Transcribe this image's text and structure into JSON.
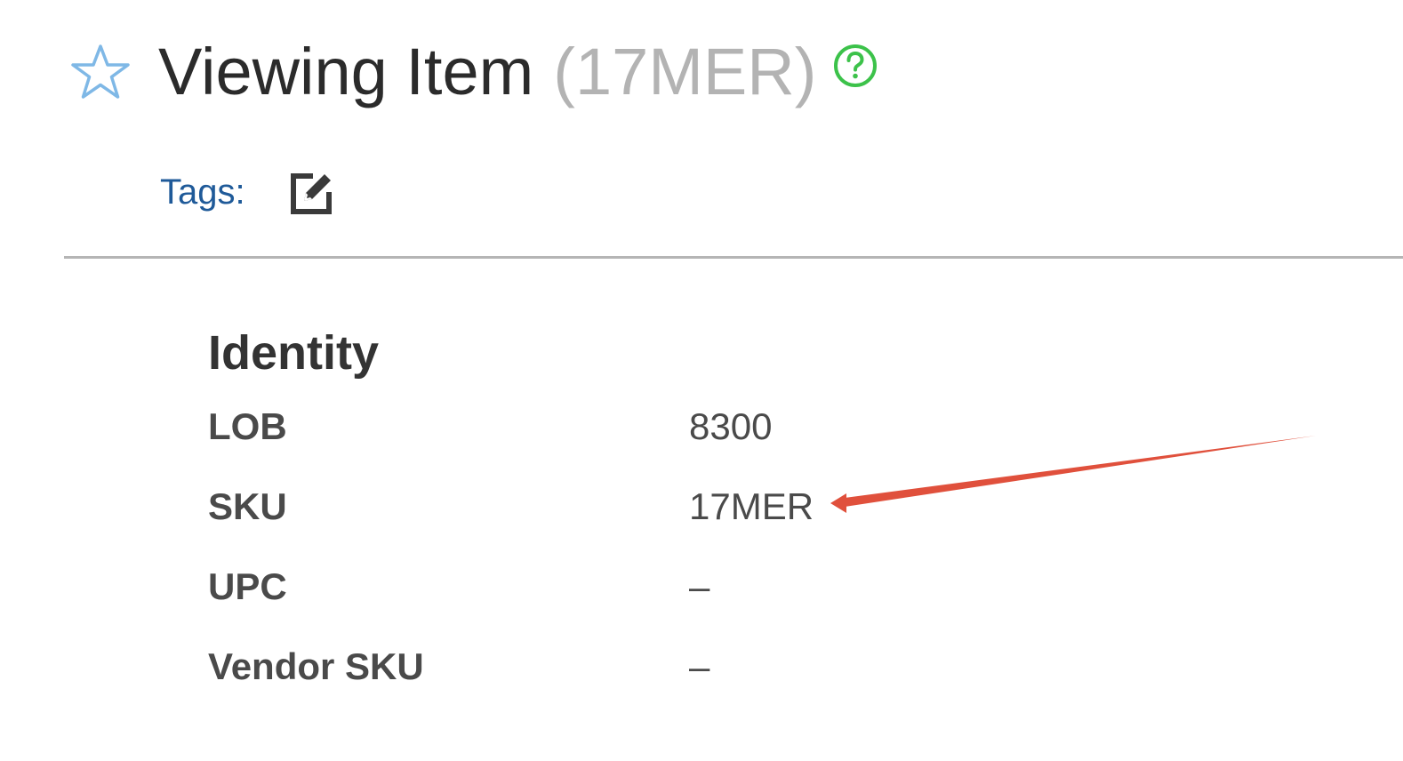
{
  "header": {
    "title": "Viewing Item",
    "item_id": "(17MER)",
    "star_icon": "star-outline-icon",
    "help_icon": "question-circle-icon"
  },
  "tags": {
    "label": "Tags:",
    "edit_icon": "edit-icon"
  },
  "identity": {
    "section_title": "Identity",
    "fields": [
      {
        "label": "LOB",
        "value": "8300"
      },
      {
        "label": "SKU",
        "value": "17MER"
      },
      {
        "label": "UPC",
        "value": "–"
      },
      {
        "label": "Vendor SKU",
        "value": "–"
      }
    ]
  },
  "colors": {
    "star": "#7fb8e6",
    "help": "#3cc24a",
    "tags_label": "#1f5a99",
    "annotation_arrow": "#e0503c"
  }
}
